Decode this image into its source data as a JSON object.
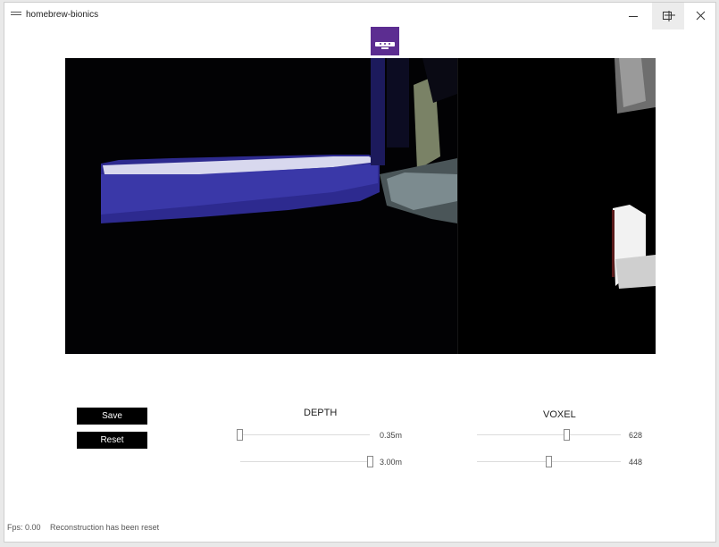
{
  "window": {
    "title": "homebrew-bionics"
  },
  "depth": {
    "label": "DEPTH",
    "min": {
      "value_label": "0.35m",
      "fraction": 0.0
    },
    "max": {
      "value_label": "3.00m",
      "fraction": 1.0
    }
  },
  "voxel": {
    "label": "VOXEL",
    "per_meter": {
      "value_label": "628",
      "fraction": 0.63
    },
    "resolution": {
      "value_label": "448",
      "fraction": 0.5
    }
  },
  "buttons": {
    "save": "Save",
    "reset": "Reset"
  },
  "status": {
    "fps": "Fps: 0.00",
    "message": "Reconstruction has been reset"
  },
  "colors": {
    "logo": "#5c2d91",
    "panel": "#000000"
  },
  "icons": {
    "app": "hamburger-icon",
    "logo": "kinect-icon",
    "minimize": "minimize-icon",
    "maximize": "maximize-icon",
    "close": "close-icon"
  }
}
